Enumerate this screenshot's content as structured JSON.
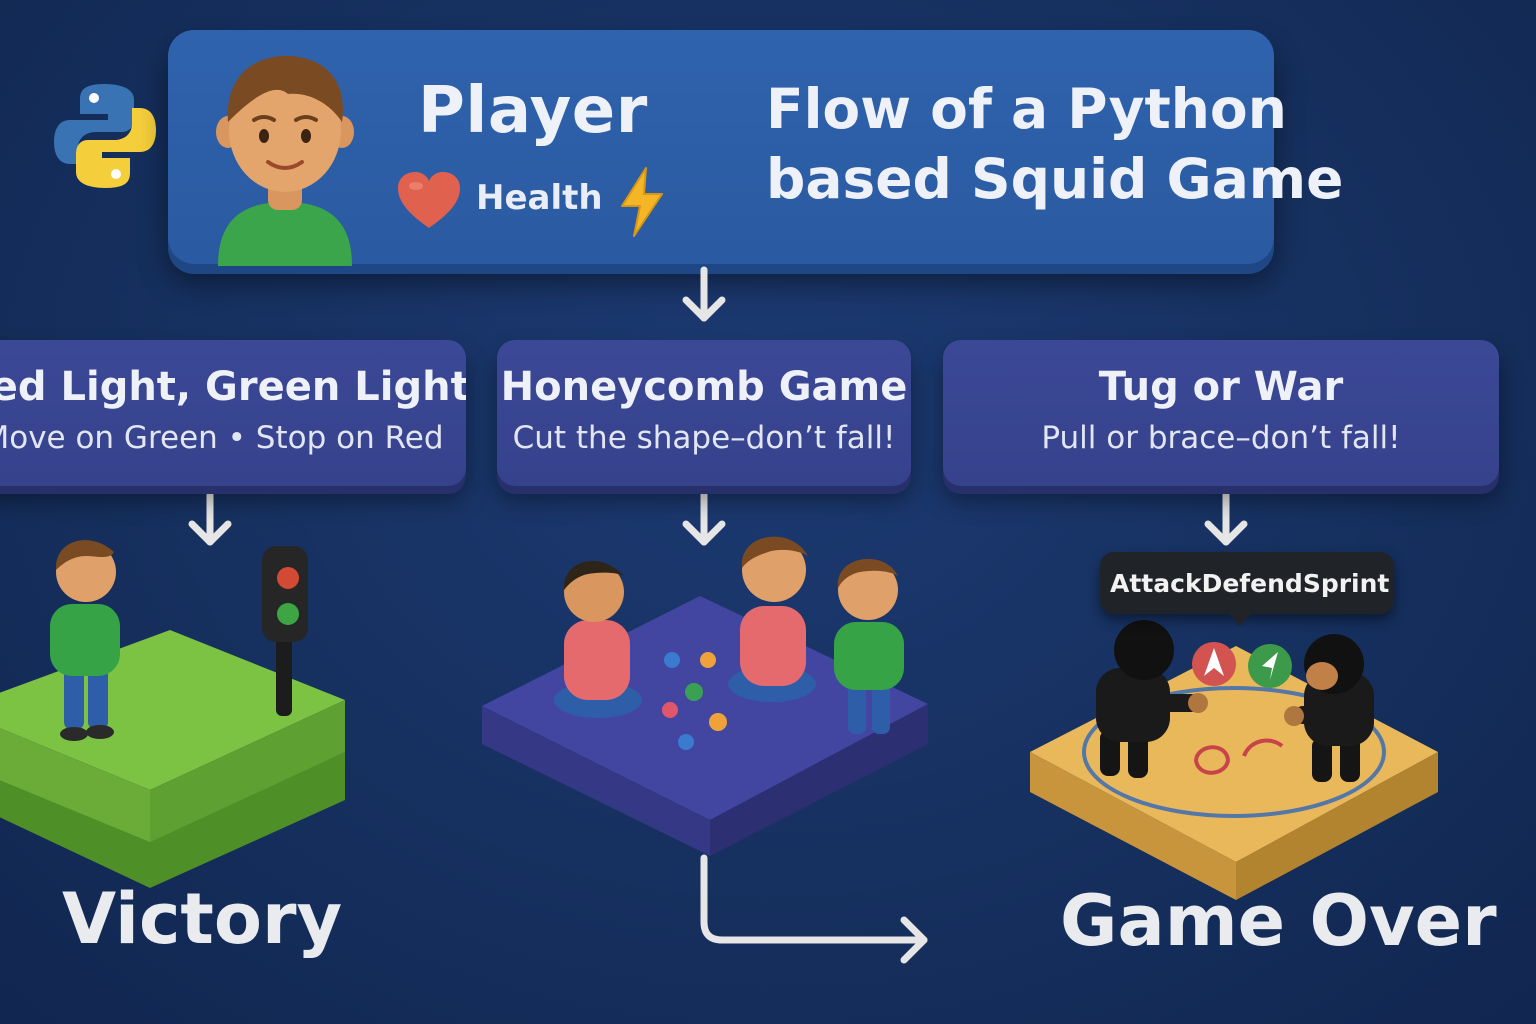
{
  "header": {
    "player_label": "Player",
    "health_label": "Health",
    "diagram_title_line1": "Flow of a Python",
    "diagram_title_line2": "based Squid Game"
  },
  "stages": [
    {
      "title": "Red Light, Green Light",
      "subtitle": "Move on Green • Stop on Red",
      "platform_color": "#7cc243"
    },
    {
      "title": "Honeycomb Game",
      "subtitle": "Cut the shape–don’t fall!",
      "platform_color": "#4346a0"
    },
    {
      "title": "Tug or War",
      "subtitle": "Pull or brace–don’t fall!",
      "platform_color": "#e8b85a"
    }
  ],
  "actions": [
    "Attack",
    "Defend",
    "Sprint"
  ],
  "outcomes": {
    "victory": "Victory",
    "game_over": "Game Over"
  },
  "colors": {
    "background": "#16305f",
    "player_card": "#2c5ea6",
    "stage_card": "#38448f",
    "arrow": "#e6e6e6"
  },
  "icons": [
    "python-logo-icon",
    "heart-icon",
    "lightning-icon",
    "traffic-light-icon",
    "attack-icon",
    "defend-icon"
  ]
}
